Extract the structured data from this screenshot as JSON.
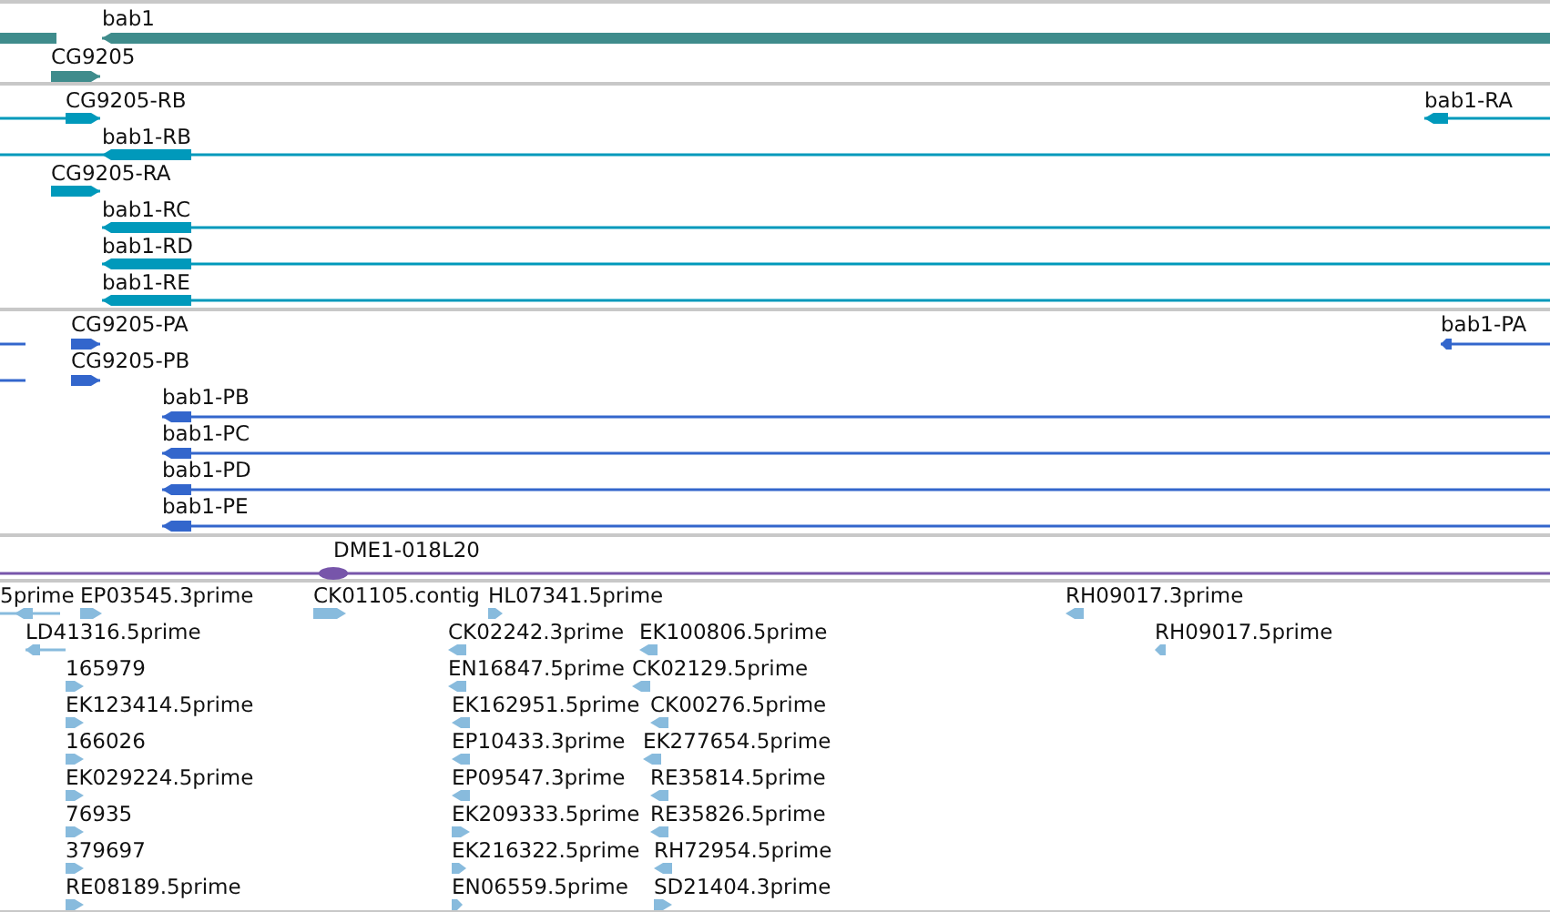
{
  "tracks": [
    {
      "color": "#3f8c8c",
      "features": [
        {
          "label": "bab1",
          "reverse": true
        },
        {
          "label": "CG9205",
          "reverse": false
        }
      ]
    },
    {
      "color": "#0099bb",
      "features": [
        {
          "label": "CG9205-RB",
          "reverse": false
        },
        {
          "label": "bab1-RA",
          "reverse": true
        },
        {
          "label": "bab1-RB",
          "reverse": true
        },
        {
          "label": "CG9205-RA",
          "reverse": false
        },
        {
          "label": "bab1-RC",
          "reverse": true
        },
        {
          "label": "bab1-RD",
          "reverse": true
        },
        {
          "label": "bab1-RE",
          "reverse": true
        }
      ]
    },
    {
      "color": "#3366cc",
      "features": [
        {
          "label": "CG9205-PA",
          "reverse": false
        },
        {
          "label": "bab1-PA",
          "reverse": true
        },
        {
          "label": "CG9205-PB",
          "reverse": false
        },
        {
          "label": "bab1-PB",
          "reverse": true
        },
        {
          "label": "bab1-PC",
          "reverse": true
        },
        {
          "label": "bab1-PD",
          "reverse": true
        },
        {
          "label": "bab1-PE",
          "reverse": true
        }
      ]
    },
    {
      "color": "#7755aa",
      "features": [
        {
          "label": "DME1-018L20"
        }
      ]
    },
    {
      "color": "#88bbdd",
      "features": [
        {
          "label": "5prime",
          "reverse": true
        },
        {
          "label": "EP03545.3prime",
          "reverse": false
        },
        {
          "label": "CK01105.contig",
          "reverse": false
        },
        {
          "label": "HL07341.5prime",
          "reverse": false
        },
        {
          "label": "RH09017.3prime",
          "reverse": true
        },
        {
          "label": "LD41316.5prime",
          "reverse": true
        },
        {
          "label": "CK02242.3prime",
          "reverse": true
        },
        {
          "label": "EK100806.5prime",
          "reverse": true
        },
        {
          "label": "RH09017.5prime",
          "reverse": true
        },
        {
          "label": "165979",
          "reverse": false
        },
        {
          "label": "EN16847.5prime",
          "reverse": true
        },
        {
          "label": "CK02129.5prime",
          "reverse": true
        },
        {
          "label": "EK123414.5prime",
          "reverse": false
        },
        {
          "label": "EK162951.5prime",
          "reverse": true
        },
        {
          "label": "CK00276.5prime",
          "reverse": true
        },
        {
          "label": "166026",
          "reverse": false
        },
        {
          "label": "EP10433.3prime",
          "reverse": true
        },
        {
          "label": "EK277654.5prime",
          "reverse": true
        },
        {
          "label": "EK029224.5prime",
          "reverse": false
        },
        {
          "label": "EP09547.3prime",
          "reverse": true
        },
        {
          "label": "RE35814.5prime",
          "reverse": true
        },
        {
          "label": "76935",
          "reverse": false
        },
        {
          "label": "EK209333.5prime",
          "reverse": false
        },
        {
          "label": "RE35826.5prime",
          "reverse": true
        },
        {
          "label": "379697",
          "reverse": false
        },
        {
          "label": "EK216322.5prime",
          "reverse": false
        },
        {
          "label": "RH72954.5prime",
          "reverse": true
        },
        {
          "label": "RE08189.5prime",
          "reverse": false
        },
        {
          "label": "EN06559.5prime",
          "reverse": false
        },
        {
          "label": "SD21404.3prime",
          "reverse": false
        }
      ]
    }
  ]
}
